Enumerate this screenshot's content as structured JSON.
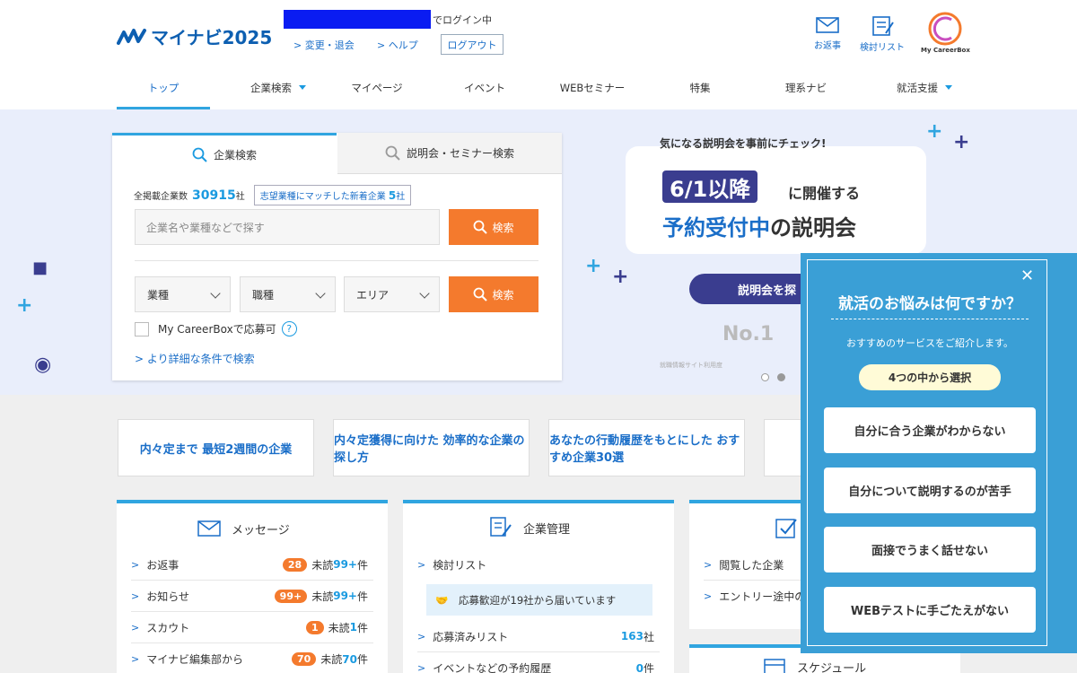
{
  "header": {
    "logo_text": "マイナビ2025",
    "login_suffix": "でログイン中",
    "link_change": "> 変更・退会",
    "link_help": "> ヘルプ",
    "logout": "ログアウト",
    "icons": [
      {
        "label": "お返事",
        "icon": "envelope-icon"
      },
      {
        "label": "検討リスト",
        "icon": "checklist-icon"
      },
      {
        "label": "My CareerBox",
        "icon": "careerbox-logo"
      }
    ]
  },
  "nav": {
    "items": [
      "トップ",
      "企業検索",
      "マイページ",
      "イベント",
      "WEBセミナー",
      "特集",
      "理系ナビ",
      "就活支援"
    ]
  },
  "search": {
    "tab_company": "企業検索",
    "tab_seminar": "説明会・セミナー検索",
    "count_label": "全掲載企業数",
    "count_value": "30915",
    "count_unit": "社",
    "match_label": "志望業種にマッチした新着企業",
    "match_count": "5",
    "match_unit": "社",
    "keyword_placeholder": "企業名や業種などで探す",
    "search_btn": "検索",
    "select_industry": "業種",
    "select_job": "職種",
    "select_area": "エリア",
    "careerbox_label": "My CareerBoxで応募可",
    "advanced": "> より詳細な条件で検索"
  },
  "hero": {
    "top": "気になる説明会を事前にチェック!",
    "date": "6/1以降",
    "l1rest": "に開催する",
    "l2_blue": "予約受付中",
    "l2_rest": "の説明会",
    "btn": "説明会を探",
    "award": "No.1",
    "award_small": "就職情報サイト利用度"
  },
  "banners": [
    {
      "text": "内々定まで 最短2週間の企業"
    },
    {
      "text": "内々定獲得に向けた 効率的な企業の探し方"
    },
    {
      "text": "あなたの行動履歴をもとにした おすすめ企業30選"
    }
  ],
  "messages": {
    "title": "メッセージ",
    "rows": [
      {
        "label": "お返事",
        "count": "28",
        "unread_pre": "未読",
        "unread": "99+",
        "unit": "件"
      },
      {
        "label": "お知らせ",
        "count": "99+",
        "unread_pre": "未読",
        "unread": "99+",
        "unit": "件"
      },
      {
        "label": "スカウト",
        "count": "1",
        "unread_pre": "未読",
        "unread": "1",
        "unit": "件"
      },
      {
        "label": "マイナビ編集部から",
        "count": "70",
        "unread_pre": "未読",
        "unread": "70",
        "unit": "件"
      }
    ]
  },
  "company": {
    "title": "企業管理",
    "row1": "検討リスト",
    "info": "応募歓迎が19社から届いています",
    "row2": "応募済みリスト",
    "row2_value": "163",
    "row2_unit": "社",
    "row3": "イベントなどの予約履歴",
    "row3_value": "0",
    "row3_unit": "件"
  },
  "third": {
    "row1": "閲覧した企業",
    "row2": "エントリー途中の",
    "schedule": "スケジュール"
  },
  "popup": {
    "title": "就活のお悩みは何ですか？",
    "sub": "おすすめのサービスをご紹介します。",
    "tag": "4つの中から選択",
    "options": [
      "自分に合う企業がわからない",
      "自分について説明するのが苦手",
      "面接でうまく話せない",
      "WEBテストに手ごたえがない"
    ]
  },
  "colors": {
    "accent": "#30a5e0",
    "orange": "#f47a2d",
    "popup": "#3a9fd6"
  }
}
